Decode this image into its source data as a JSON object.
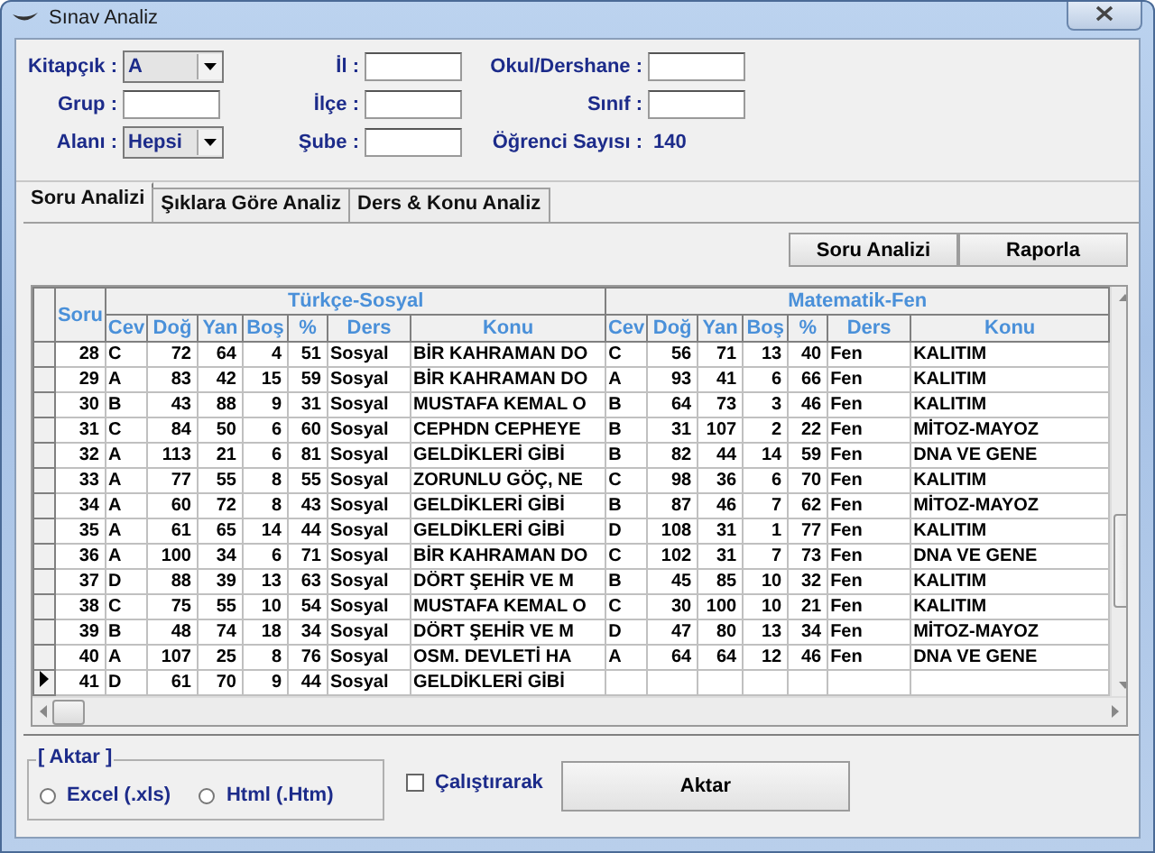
{
  "window": {
    "title": "Sınav Analiz"
  },
  "filters": [
    [
      {
        "label": "Kitapçık :",
        "kind": "dropdown",
        "value": "A"
      },
      {
        "label": "Grup :",
        "kind": "text"
      },
      {
        "label": "Alanı :",
        "kind": "dropdown",
        "value": "Hepsi"
      }
    ],
    [
      {
        "label": "İl :",
        "kind": "text"
      },
      {
        "label": "İlçe :",
        "kind": "text"
      },
      {
        "label": "Şube :",
        "kind": "text"
      }
    ],
    [
      {
        "label": "Okul/Dershane :",
        "kind": "text"
      },
      {
        "label": "Sınıf :",
        "kind": "text"
      },
      {
        "label": "Öğrenci Sayısı :",
        "kind": "readout",
        "value": "140"
      }
    ]
  ],
  "tabs": [
    {
      "label": "Soru Analizi",
      "selected": true
    },
    {
      "label": "Şıklara Göre Analiz",
      "selected": false
    },
    {
      "label": "Ders & Konu Analiz",
      "selected": false
    }
  ],
  "toolbar_buttons": [
    "Soru Analizi",
    "Raporla"
  ],
  "table": {
    "soru_header": "Soru",
    "groups": [
      {
        "title": "Türkçe-Sosyal",
        "columns": [
          "Cev",
          "Doğ",
          "Yan",
          "Boş",
          "%",
          "Ders",
          "Konu"
        ]
      },
      {
        "title": "Matematik-Fen",
        "columns": [
          "Cev",
          "Doğ",
          "Yan",
          "Boş",
          "%",
          "Ders",
          "Konu"
        ]
      }
    ],
    "rows": [
      {
        "soru": "28",
        "current": false,
        "ts": [
          "C",
          "72",
          "64",
          "4",
          "51",
          "Sosyal",
          "BİR KAHRAMAN DO"
        ],
        "mf": [
          "C",
          "56",
          "71",
          "13",
          "40",
          "Fen",
          "KALITIM"
        ]
      },
      {
        "soru": "29",
        "current": false,
        "ts": [
          "A",
          "83",
          "42",
          "15",
          "59",
          "Sosyal",
          "BİR KAHRAMAN DO"
        ],
        "mf": [
          "A",
          "93",
          "41",
          "6",
          "66",
          "Fen",
          "KALITIM"
        ]
      },
      {
        "soru": "30",
        "current": false,
        "ts": [
          "B",
          "43",
          "88",
          "9",
          "31",
          "Sosyal",
          "MUSTAFA KEMAL O"
        ],
        "mf": [
          "B",
          "64",
          "73",
          "3",
          "46",
          "Fen",
          "KALITIM"
        ]
      },
      {
        "soru": "31",
        "current": false,
        "ts": [
          "C",
          "84",
          "50",
          "6",
          "60",
          "Sosyal",
          "CEPHDN CEPHEYE"
        ],
        "mf": [
          "B",
          "31",
          "107",
          "2",
          "22",
          "Fen",
          "MİTOZ-MAYOZ"
        ]
      },
      {
        "soru": "32",
        "current": false,
        "ts": [
          "A",
          "113",
          "21",
          "6",
          "81",
          "Sosyal",
          "GELDİKLERİ GİBİ"
        ],
        "mf": [
          "B",
          "82",
          "44",
          "14",
          "59",
          "Fen",
          "DNA VE GENE"
        ]
      },
      {
        "soru": "33",
        "current": false,
        "ts": [
          "A",
          "77",
          "55",
          "8",
          "55",
          "Sosyal",
          "ZORUNLU GÖÇ, NE"
        ],
        "mf": [
          "C",
          "98",
          "36",
          "6",
          "70",
          "Fen",
          "KALITIM"
        ]
      },
      {
        "soru": "34",
        "current": false,
        "ts": [
          "A",
          "60",
          "72",
          "8",
          "43",
          "Sosyal",
          "GELDİKLERİ GİBİ"
        ],
        "mf": [
          "B",
          "87",
          "46",
          "7",
          "62",
          "Fen",
          "MİTOZ-MAYOZ"
        ]
      },
      {
        "soru": "35",
        "current": false,
        "ts": [
          "A",
          "61",
          "65",
          "14",
          "44",
          "Sosyal",
          "GELDİKLERİ GİBİ"
        ],
        "mf": [
          "D",
          "108",
          "31",
          "1",
          "77",
          "Fen",
          "KALITIM"
        ]
      },
      {
        "soru": "36",
        "current": false,
        "ts": [
          "A",
          "100",
          "34",
          "6",
          "71",
          "Sosyal",
          "BİR KAHRAMAN DO"
        ],
        "mf": [
          "C",
          "102",
          "31",
          "7",
          "73",
          "Fen",
          "DNA VE GENE"
        ]
      },
      {
        "soru": "37",
        "current": false,
        "ts": [
          "D",
          "88",
          "39",
          "13",
          "63",
          "Sosyal",
          "DÖRT ŞEHİR VE M"
        ],
        "mf": [
          "B",
          "45",
          "85",
          "10",
          "32",
          "Fen",
          "KALITIM"
        ]
      },
      {
        "soru": "38",
        "current": false,
        "ts": [
          "C",
          "75",
          "55",
          "10",
          "54",
          "Sosyal",
          "MUSTAFA KEMAL O"
        ],
        "mf": [
          "C",
          "30",
          "100",
          "10",
          "21",
          "Fen",
          "KALITIM"
        ]
      },
      {
        "soru": "39",
        "current": false,
        "ts": [
          "B",
          "48",
          "74",
          "18",
          "34",
          "Sosyal",
          "DÖRT ŞEHİR VE M"
        ],
        "mf": [
          "D",
          "47",
          "80",
          "13",
          "34",
          "Fen",
          "MİTOZ-MAYOZ"
        ]
      },
      {
        "soru": "40",
        "current": false,
        "ts": [
          "A",
          "107",
          "25",
          "8",
          "76",
          "Sosyal",
          "OSM. DEVLETİ HA"
        ],
        "mf": [
          "A",
          "64",
          "64",
          "12",
          "46",
          "Fen",
          "DNA VE GENE"
        ]
      },
      {
        "soru": "41",
        "current": true,
        "ts": [
          "D",
          "61",
          "70",
          "9",
          "44",
          "Sosyal",
          "GELDİKLERİ GİBİ"
        ],
        "mf": null
      }
    ]
  },
  "export": {
    "title": "[ Aktar ]",
    "options": [
      {
        "label": "Excel (.xls)",
        "selected": false
      },
      {
        "label": "Html (.Htm)",
        "selected": false
      }
    ],
    "run_checkbox": {
      "label": "Çalıştırarak",
      "checked": false
    },
    "button": "Aktar"
  }
}
